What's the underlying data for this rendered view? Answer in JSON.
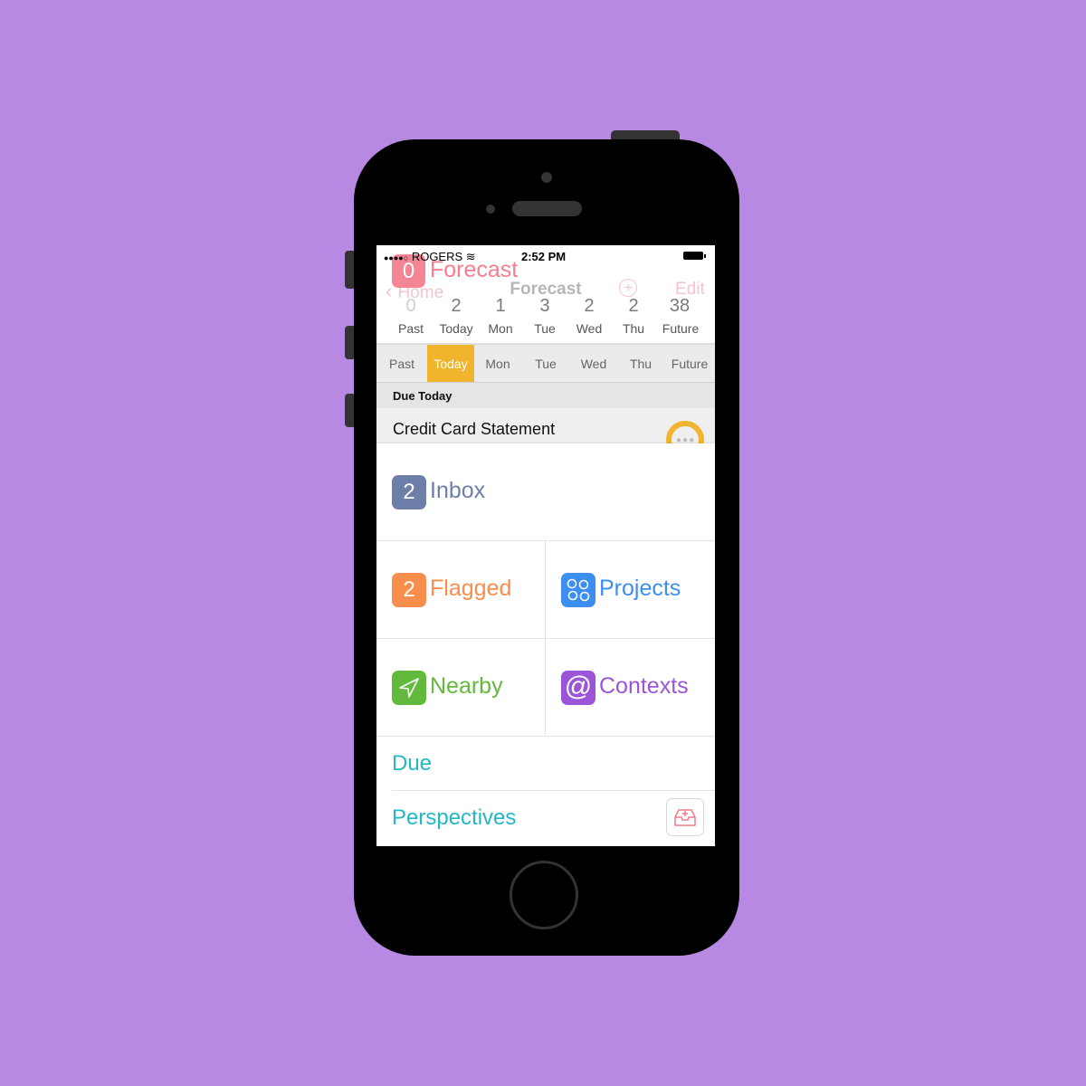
{
  "status_bar": {
    "signal": "●●●●○",
    "carrier": "ROGERS",
    "time": "2:52 PM"
  },
  "header_overlay": {
    "forecast_count": "0",
    "forecast_label": "Forecast"
  },
  "nav_bar": {
    "back_label": "Home",
    "title": "Forecast",
    "add_icon": "plus-circle-icon",
    "edit_label": "Edit"
  },
  "forecast_strip": {
    "counts": [
      "0",
      "2",
      "1",
      "3",
      "2",
      "2",
      "38"
    ],
    "days": [
      "Past",
      "Today",
      "Mon",
      "Tue",
      "Wed",
      "Thu",
      "Future"
    ]
  },
  "tabs": {
    "items": [
      "Past",
      "Today",
      "Mon",
      "Tue",
      "Wed",
      "Thu",
      "Future"
    ],
    "active": "Today",
    "accent": "#f0b52c"
  },
  "section": {
    "title": "Due Today"
  },
  "task": {
    "title": "Credit Card Statement",
    "status_icon": "more-dots-icon"
  },
  "home_menu": {
    "inbox": {
      "count": "2",
      "label": "Inbox",
      "color": "#6d7fa8"
    },
    "flagged": {
      "count": "2",
      "label": "Flagged",
      "color": "#f98d4b"
    },
    "projects": {
      "label": "Projects",
      "color": "#3c8ef0",
      "icon": "projects-icon"
    },
    "nearby": {
      "label": "Nearby",
      "color": "#63b93c",
      "icon": "location-arrow-icon"
    },
    "contexts": {
      "label": "Contexts",
      "color": "#9c55d8",
      "icon": "at-icon"
    },
    "due": {
      "label": "Due",
      "color": "#24b8c4"
    },
    "perspectives": {
      "label": "Perspectives",
      "color": "#24b8c4",
      "icon": "inbox-add-icon"
    }
  }
}
